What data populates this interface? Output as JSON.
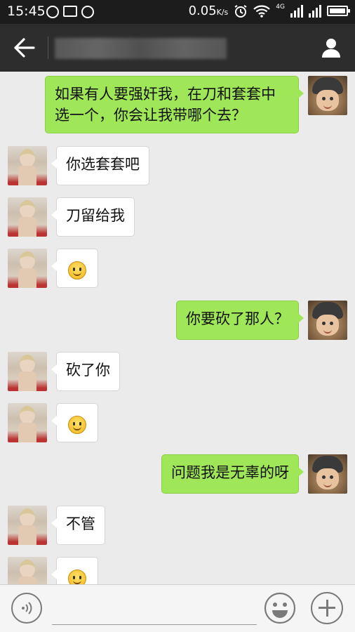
{
  "status_bar": {
    "time": "15:45",
    "speed": "0.05",
    "speed_unit": "K/s",
    "network": "4G"
  },
  "header": {
    "contact_name": ""
  },
  "messages": [
    {
      "from": "me",
      "text": "如果有人要强奸我，在刀和套套中\n选一个，你会让我带哪个去？"
    },
    {
      "from": "other",
      "text": "你选套套吧"
    },
    {
      "from": "other",
      "text": "刀留给我"
    },
    {
      "from": "other",
      "emoji": "smile-emoji"
    },
    {
      "from": "me",
      "text": "你要砍了那人？"
    },
    {
      "from": "other",
      "text": "砍了你"
    },
    {
      "from": "other",
      "emoji": "smile-emoji"
    },
    {
      "from": "me",
      "text": "问题我是无辜的呀"
    },
    {
      "from": "other",
      "text": "不管"
    },
    {
      "from": "other",
      "emoji": "smile-emoji"
    }
  ],
  "input": {
    "value": ""
  },
  "colors": {
    "my_bubble": "#9fe658",
    "other_bubble": "#ffffff",
    "header_bg": "#2d2d2d",
    "chat_bg": "#ebebeb"
  }
}
